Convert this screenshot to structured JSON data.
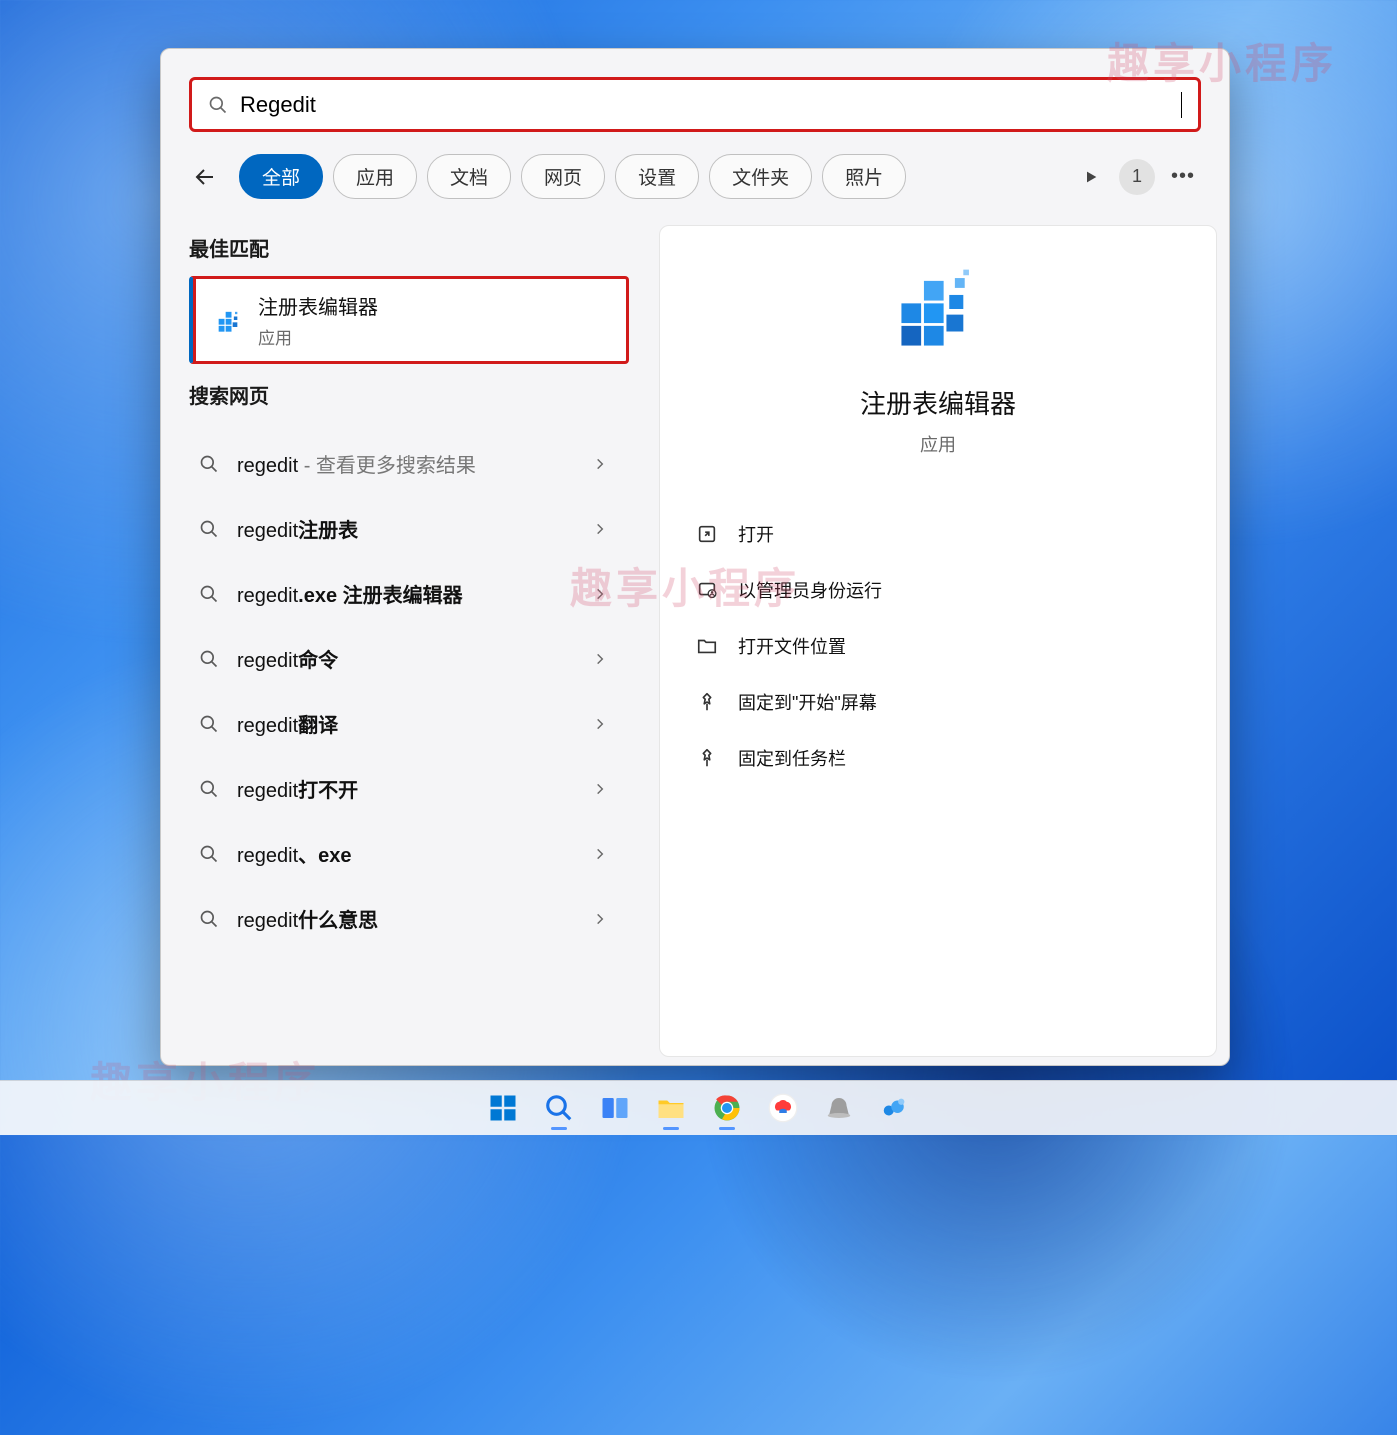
{
  "watermark": "趣享小程序",
  "search": {
    "value": "Regedit"
  },
  "tabs": {
    "items": [
      {
        "label": "全部"
      },
      {
        "label": "应用"
      },
      {
        "label": "文档"
      },
      {
        "label": "网页"
      },
      {
        "label": "设置"
      },
      {
        "label": "文件夹"
      },
      {
        "label": "照片"
      }
    ],
    "badge": "1"
  },
  "best_match": {
    "heading": "最佳匹配",
    "name": "注册表编辑器",
    "sub": "应用"
  },
  "web_search": {
    "heading": "搜索网页",
    "items": [
      {
        "prefix": "regedit",
        "suffix": " - 查看更多搜索结果",
        "suffix_hint": true
      },
      {
        "prefix": "regedit",
        "suffix": "注册表"
      },
      {
        "prefix": "regedit",
        "suffix": ".exe 注册表编辑器"
      },
      {
        "prefix": "regedit",
        "suffix": "命令"
      },
      {
        "prefix": "regedit",
        "suffix": "翻译"
      },
      {
        "prefix": "regedit",
        "suffix": "打不开"
      },
      {
        "prefix": "regedit",
        "suffix": "、exe"
      },
      {
        "prefix": "regedit",
        "suffix": "什么意思"
      }
    ]
  },
  "detail": {
    "title": "注册表编辑器",
    "sub": "应用",
    "actions": [
      {
        "icon": "open",
        "label": "打开"
      },
      {
        "icon": "admin",
        "label": "以管理员身份运行"
      },
      {
        "icon": "folder",
        "label": "打开文件位置"
      },
      {
        "icon": "pin",
        "label": "固定到\"开始\"屏幕"
      },
      {
        "icon": "pin",
        "label": "固定到任务栏"
      }
    ]
  },
  "taskbar": {
    "items": [
      {
        "name": "start"
      },
      {
        "name": "search"
      },
      {
        "name": "taskview"
      },
      {
        "name": "explorer"
      },
      {
        "name": "chrome"
      },
      {
        "name": "baidu"
      },
      {
        "name": "app1"
      },
      {
        "name": "app2"
      }
    ]
  }
}
